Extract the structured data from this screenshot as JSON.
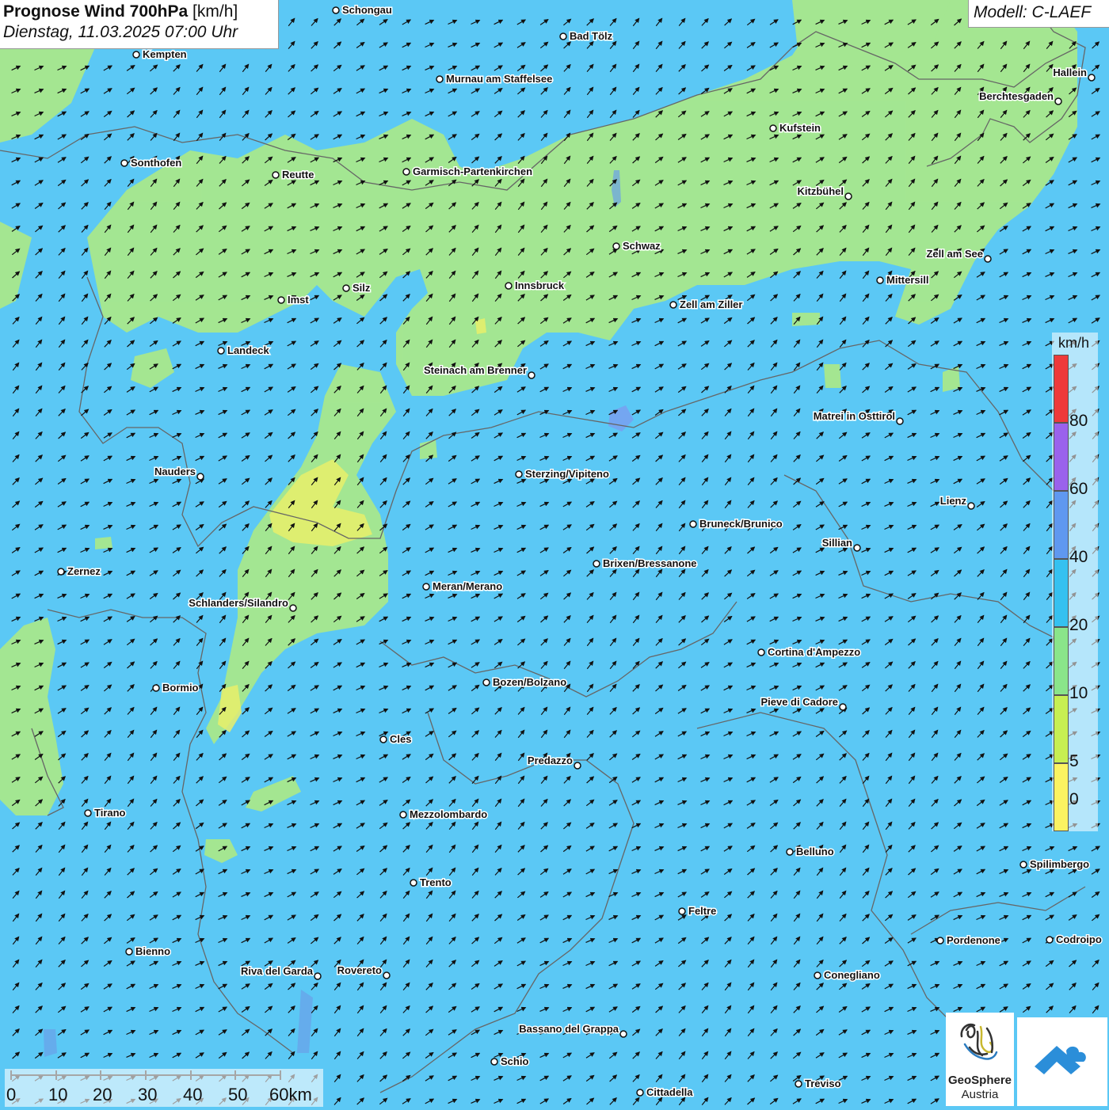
{
  "header": {
    "title_bold": "Prognose Wind 700hPa",
    "title_unit": "[km/h]",
    "datetime": "Dienstag, 11.03.2025 07:00 Uhr",
    "model": "Modell: C-LAEF"
  },
  "legend": {
    "unit": "km/h",
    "labels": [
      "80",
      "60",
      "40",
      "20",
      "10",
      "5",
      "0"
    ],
    "colors": [
      "#ee3a3a",
      "#9a62ec",
      "#5f98f0",
      "#35c1f0",
      "#8ae58a",
      "#c7ef52",
      "#fbf361"
    ]
  },
  "scalebar": {
    "labels": [
      "0",
      "10",
      "20",
      "30",
      "40",
      "50",
      "60km"
    ]
  },
  "logos": {
    "geosphere_line1": "GeoSphere",
    "geosphere_line2": "Austria"
  },
  "colors": {
    "calm_yellow": "#e9ee6a",
    "light_green": "#a8e88c",
    "sky_blue": "#5bc8f5",
    "border_gray": "#666666"
  },
  "cities": [
    {
      "name": "Schongau"
    },
    {
      "name": "Bad Tölz"
    },
    {
      "name": "Kempten"
    },
    {
      "name": "Murnau am Staffelsee"
    },
    {
      "name": "Hallein"
    },
    {
      "name": "Berchtesgaden"
    },
    {
      "name": "Kufstein"
    },
    {
      "name": "Sonthofen"
    },
    {
      "name": "Reutte"
    },
    {
      "name": "Garmisch-Partenkirchen"
    },
    {
      "name": "Kitzbühel"
    },
    {
      "name": "Schwaz"
    },
    {
      "name": "Zell am See"
    },
    {
      "name": "Mittersill"
    },
    {
      "name": "Innsbruck"
    },
    {
      "name": "Silz"
    },
    {
      "name": "Imst"
    },
    {
      "name": "Zell am Ziller"
    },
    {
      "name": "Landeck"
    },
    {
      "name": "Steinach am Brenner"
    },
    {
      "name": "Matrei in Osttirol"
    },
    {
      "name": "Nauders"
    },
    {
      "name": "Sterzing/Vipiteno"
    },
    {
      "name": "Lienz"
    },
    {
      "name": "Bruneck/Brunico"
    },
    {
      "name": "Sillian"
    },
    {
      "name": "Zernez"
    },
    {
      "name": "Brixen/Bressanone"
    },
    {
      "name": "Meran/Merano"
    },
    {
      "name": "Schlanders/Silandro"
    },
    {
      "name": "Cortina d'Ampezzo"
    },
    {
      "name": "Bormio"
    },
    {
      "name": "Bozen/Bolzano"
    },
    {
      "name": "Pieve di Cadore"
    },
    {
      "name": "Cles"
    },
    {
      "name": "Predazzo"
    },
    {
      "name": "Tirano"
    },
    {
      "name": "Mezzolombardo"
    },
    {
      "name": "Belluno"
    },
    {
      "name": "Spilimbergo"
    },
    {
      "name": "Trento"
    },
    {
      "name": "Feltre"
    },
    {
      "name": "Pordenone"
    },
    {
      "name": "Codroipo"
    },
    {
      "name": "Bienno"
    },
    {
      "name": "Riva del Garda"
    },
    {
      "name": "Rovereto"
    },
    {
      "name": "Conegliano"
    },
    {
      "name": "Bassano del Grappa"
    },
    {
      "name": "Schio"
    },
    {
      "name": "Treviso"
    },
    {
      "name": "Cittadella"
    }
  ]
}
